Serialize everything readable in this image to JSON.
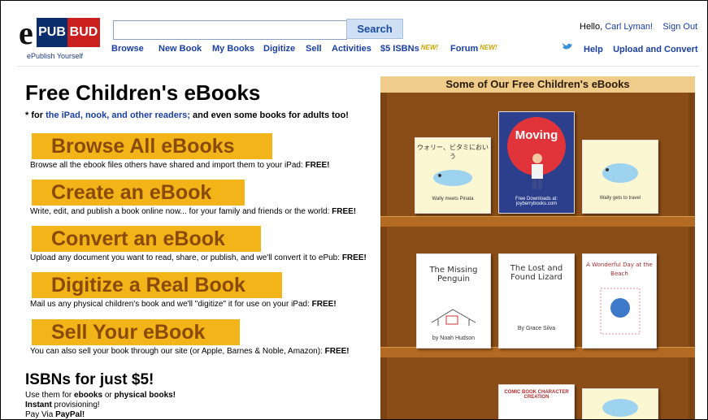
{
  "header": {
    "logo": {
      "e": "e",
      "pub": "PUB",
      "bud": "BUD",
      "tagline": "ePublish Yourself"
    },
    "search_button": "Search",
    "search_placeholder": "",
    "nav": [
      "Browse",
      "New Book",
      "My Books",
      "Digitize",
      "Sell",
      "Activities",
      "$5 ISBNs",
      "Forum"
    ],
    "new_badge": "NEW!",
    "greeting": "Hello,",
    "user_name": "Carl Lyman!",
    "sign_out": "Sign Out",
    "help": "Help",
    "upload": "Upload and Convert"
  },
  "main": {
    "title": "Free Children's eBooks",
    "sub_prefix": "* for ",
    "sub_link": "the iPad, nook, and other readers;",
    "sub_suffix": " and even some books for adults too!",
    "actions": [
      {
        "label": "Browse All eBooks",
        "desc": "Browse all the ebook files others have shared and import them to your iPad: ",
        "free": "FREE!"
      },
      {
        "label": "Create an eBook",
        "desc": "Write, edit, and publish a book online now... for your family and friends or the world: ",
        "free": "FREE!"
      },
      {
        "label": "Convert an eBook",
        "desc": "Upload any document you want to read, share, or publish, and we'll convert it to ePub: ",
        "free": "FREE!"
      },
      {
        "label": "Digitize a Real Book",
        "desc": "Mail us any physical children's book and we'll \"digitize\" it for use on your iPad: ",
        "free": "FREE!"
      },
      {
        "label": "Sell Your eBook",
        "desc": "You can also sell your book through our site (or Apple, Barnes & Noble, Amazon): ",
        "free": "FREE!"
      }
    ],
    "isbn_title": "ISBNs for just $5!",
    "isbn_lines": [
      {
        "a": "Use them for ",
        "b": "ebooks",
        "c": " or ",
        "d": "physical books!"
      },
      {
        "a": "",
        "b": "Instant",
        "c": " provisioning!",
        "d": ""
      },
      {
        "a": "Pay Via ",
        "b": "PayPal!",
        "c": "",
        "d": ""
      }
    ]
  },
  "shelf": {
    "title": "Some of Our Free Children's eBooks",
    "books": {
      "b1": {
        "title": "ウォリー、ビタミにおいう",
        "caption": "Wally meets Pinata"
      },
      "b2": {
        "title": "Moving",
        "caption": "Free Downloads at: joyberrybooks.com"
      },
      "b3": {
        "title": "",
        "caption": "Wally gets to travel"
      },
      "b4": {
        "title": "The Missing Penguin",
        "caption": "by Noah Hudson"
      },
      "b5": {
        "title": "The Lost and Found Lizard",
        "caption": "By Grace Silva"
      },
      "b6": {
        "title": "A Wonderful Day at the Beach",
        "caption": ""
      },
      "b7": {
        "title": "COMIC BOOK CHARACTER CREATION",
        "caption": ""
      }
    }
  }
}
